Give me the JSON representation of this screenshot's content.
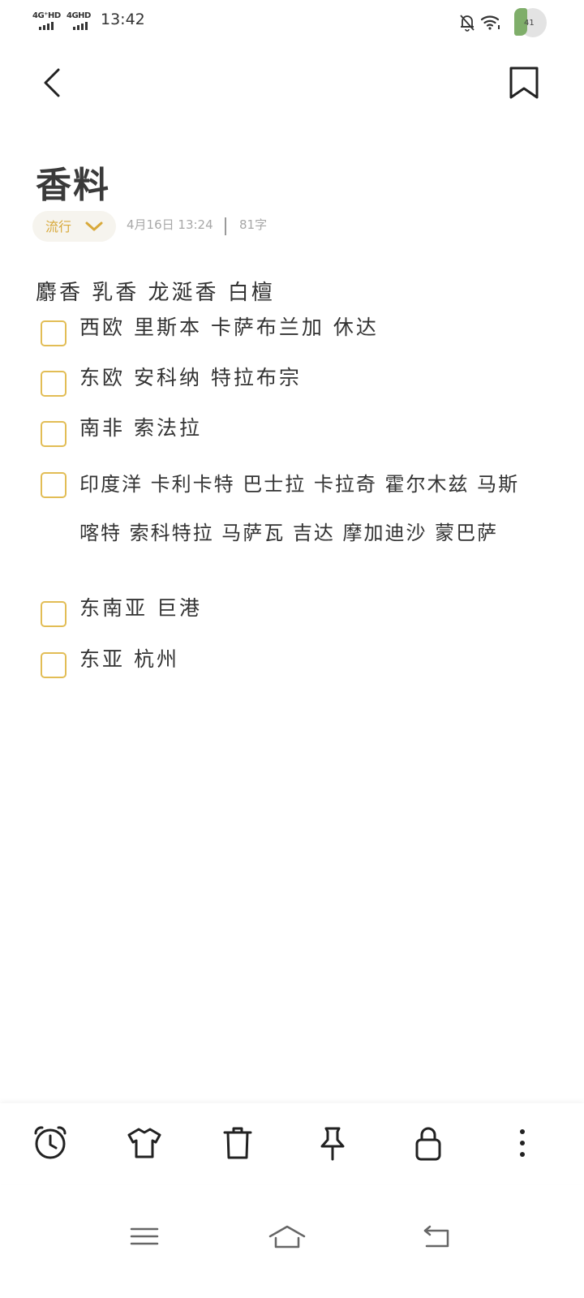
{
  "status_bar": {
    "sim1_label": "4G⁺HD",
    "sim2_label": "4GHD",
    "time": "13:42",
    "battery_level": "41",
    "icons": [
      "signal-icon",
      "bell-off-icon",
      "wifi-icon",
      "battery-badge-icon"
    ]
  },
  "header": {
    "back_icon": "chevron-left-icon",
    "bookmark_icon": "bookmark-icon"
  },
  "note": {
    "title": "香料",
    "folder_label": "流行",
    "date": "4月16日 13:24",
    "char_count": "81字",
    "intro_line": "麝香 乳香 龙涎香 白檀",
    "checklist": [
      {
        "text": "西欧 里斯本 卡萨布兰加 休达",
        "checked": false
      },
      {
        "text": "东欧 安科纳 特拉布宗",
        "checked": false
      },
      {
        "text": "南非 索法拉",
        "checked": false
      },
      {
        "text": "印度洋 卡利卡特 巴士拉 卡拉奇 霍尔木兹 马斯喀特 索科特拉 马萨瓦 吉达 摩加迪沙 蒙巴萨",
        "checked": false
      },
      {
        "text": "东南亚 巨港",
        "checked": false
      },
      {
        "text": "东亚 杭州",
        "checked": false
      }
    ]
  },
  "toolbar": {
    "items": [
      "alarm-clock-icon",
      "shirt-icon",
      "trash-icon",
      "pin-icon",
      "lock-icon",
      "more-vertical-icon"
    ]
  },
  "navbar": {
    "items": [
      "menu-icon",
      "home-icon",
      "back-nav-icon"
    ]
  },
  "colors": {
    "accent": "#e2bd55",
    "accent_text": "#d8a93a",
    "chip_bg": "#f6f4ee",
    "meta_text": "#a8a8a8",
    "body_text": "#333333"
  }
}
